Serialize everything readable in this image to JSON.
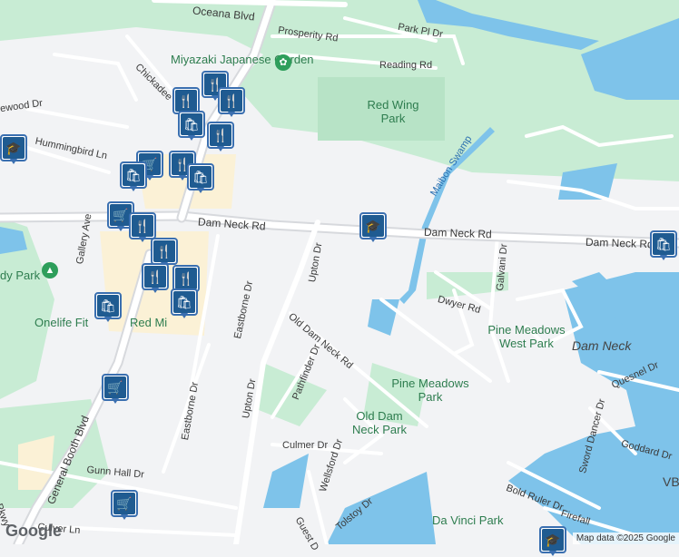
{
  "map": {
    "roads": [
      {
        "label": "Oceana Blvd"
      },
      {
        "label": "Prosperity Rd"
      },
      {
        "label": "Park Pl Dr"
      },
      {
        "label": "Reading Rd"
      },
      {
        "label": "Chickadee"
      },
      {
        "label": "ewood Dr"
      },
      {
        "label": "Hummingbird Ln"
      },
      {
        "label": "Dam Neck Rd"
      },
      {
        "label": "Dam Neck Rd"
      },
      {
        "label": "Dam Neck Rd"
      },
      {
        "label": "Gallery Ave"
      },
      {
        "label": "Upton Dr"
      },
      {
        "label": "Eastborne Dr"
      },
      {
        "label": "Old Dam Neck Rd"
      },
      {
        "label": "Pathfinder Dr"
      },
      {
        "label": "Upton Dr"
      },
      {
        "label": "Eastborne Dr"
      },
      {
        "label": "Dwyer Rd"
      },
      {
        "label": "Galvani Dr"
      },
      {
        "label": "General Booth Blvd"
      },
      {
        "label": "Culmer Dr"
      },
      {
        "label": "Wellsford Dr"
      },
      {
        "label": "Gunn Hall Dr"
      },
      {
        "label": "Tolstoy Dr"
      },
      {
        "label": "Bold Ruler Dr"
      },
      {
        "label": "Culver Ln"
      },
      {
        "label": "Guest D"
      },
      {
        "label": "Quesnel Dr"
      },
      {
        "label": "Sword Dancer Dr"
      },
      {
        "label": "Goddard Dr"
      },
      {
        "label": "Firefall"
      },
      {
        "label": "Maibon Swamp"
      },
      {
        "label": "g Pkwy"
      }
    ],
    "parks": [
      {
        "label": "Miyazaki Japanese Garden"
      },
      {
        "label": "Red Wing Park"
      },
      {
        "label": "Pine Meadows West Park"
      },
      {
        "label": "Pine Meadows Park"
      },
      {
        "label": "Old Dam Neck Park"
      },
      {
        "label": "Da Vinci Park"
      },
      {
        "label": "dy Park"
      },
      {
        "label": "Onelife Fit"
      },
      {
        "label": "Red Mi"
      }
    ],
    "areas": [
      {
        "label": "Dam Neck"
      },
      {
        "label": "VB"
      }
    ],
    "pois": [
      {
        "icon": "restaurant-icon"
      },
      {
        "icon": "restaurant-icon"
      },
      {
        "icon": "restaurant-icon"
      },
      {
        "icon": "shopping-bag-icon"
      },
      {
        "icon": "restaurant-icon"
      },
      {
        "icon": "school-icon"
      },
      {
        "icon": "shopping-cart-icon"
      },
      {
        "icon": "restaurant-icon"
      },
      {
        "icon": "shopping-bag-icon"
      },
      {
        "icon": "shopping-bag-icon"
      },
      {
        "icon": "shopping-cart-icon"
      },
      {
        "icon": "restaurant-icon"
      },
      {
        "icon": "restaurant-icon"
      },
      {
        "icon": "restaurant-icon"
      },
      {
        "icon": "restaurant-icon"
      },
      {
        "icon": "shopping-bag-icon"
      },
      {
        "icon": "shopping-bag-icon"
      },
      {
        "icon": "school-icon"
      },
      {
        "icon": "shopping-bag-icon"
      },
      {
        "icon": "shopping-cart-icon"
      },
      {
        "icon": "shopping-cart-icon"
      },
      {
        "icon": "school-icon"
      }
    ],
    "colors": {
      "land": "#f2f3f5",
      "park": "#c8ecd4",
      "water": "#7ec3ea",
      "road": "#ffffff",
      "major_road": "#d7d9dd",
      "commercial": "#fbf1d6",
      "poi": "#1f5b91"
    }
  },
  "branding": {
    "logo": "Google",
    "attribution": "Map data ©2025 Google"
  }
}
